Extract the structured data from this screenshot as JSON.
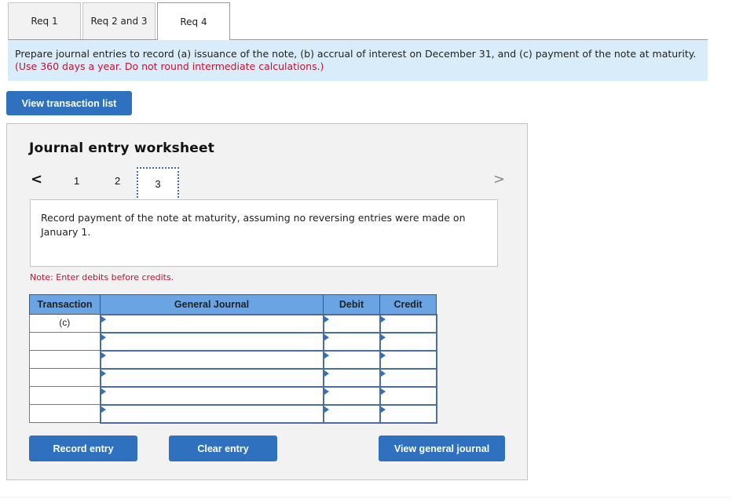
{
  "tabs": [
    {
      "label": "Req 1",
      "active": false
    },
    {
      "label": "Req 2 and 3",
      "active": false
    },
    {
      "label": "Req 4",
      "active": true
    }
  ],
  "instructions": {
    "text": "Prepare journal entries to record (a) issuance of the note, (b) accrual of interest on December 31, and (c) payment of the note at maturity.",
    "emphasis": "(Use 360 days a year. Do not round intermediate calculations.)"
  },
  "view_transaction_list_label": "View transaction list",
  "worksheet": {
    "title": "Journal entry worksheet",
    "pages": [
      "1",
      "2",
      "3"
    ],
    "current_page": "3",
    "prev_icon": "<",
    "next_icon": ">",
    "description": "Record payment of the note at maturity, assuming no reversing entries were made on January 1.",
    "note": "Note: Enter debits before credits.",
    "table": {
      "headers": [
        "Transaction",
        "General Journal",
        "Debit",
        "Credit"
      ],
      "rows": [
        {
          "transaction": "(c)",
          "account": "",
          "debit": "",
          "credit": ""
        },
        {
          "transaction": "",
          "account": "",
          "debit": "",
          "credit": ""
        },
        {
          "transaction": "",
          "account": "",
          "debit": "",
          "credit": ""
        },
        {
          "transaction": "",
          "account": "",
          "debit": "",
          "credit": ""
        },
        {
          "transaction": "",
          "account": "",
          "debit": "",
          "credit": ""
        },
        {
          "transaction": "",
          "account": "",
          "debit": "",
          "credit": ""
        }
      ]
    },
    "buttons": {
      "record": "Record entry",
      "clear": "Clear entry",
      "view_journal": "View general journal"
    }
  },
  "colors": {
    "accent": "#2f71bf",
    "instruction_bg": "#d9ecf9",
    "header_bg": "#6aa4e2",
    "warning_red": "#c8102e"
  }
}
